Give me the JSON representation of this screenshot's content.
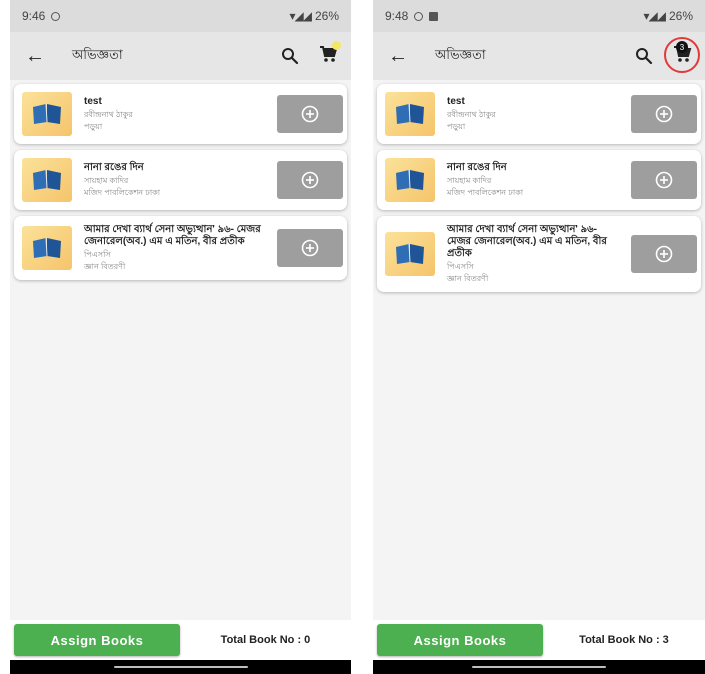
{
  "screens": [
    {
      "status": {
        "time": "9:46",
        "battery": "26%"
      },
      "appbar": {
        "title": "অভিজ্ঞতা",
        "cart_badge": ""
      },
      "books": [
        {
          "title": "test",
          "lines": [
            "রবীন্দ্রনাথ ঠাকুর",
            "পড়ুয়া"
          ]
        },
        {
          "title": "নানা রঙের দিন",
          "lines": [
            "সায়হাম কাদির",
            "মজিদ পাবলিকেশন ঢাকা"
          ]
        },
        {
          "title": "আমার দেখা ব্যার্থ সেনা অভ্যুত্থান' ৯৬- মেজর জেনারেল(অব.) এম এ মতিন, বীর প্রতীক",
          "lines": [
            "পিএসসি",
            "জ্ঞান বিতরণী"
          ]
        }
      ],
      "bottom": {
        "assign_label": "Assign Books",
        "total_label": "Total Book No : 0"
      }
    },
    {
      "status": {
        "time": "9:48",
        "battery": "26%"
      },
      "appbar": {
        "title": "অভিজ্ঞতা",
        "cart_badge": "3"
      },
      "books": [
        {
          "title": "test",
          "lines": [
            "রবীন্দ্রনাথ ঠাকুর",
            "পড়ুয়া"
          ]
        },
        {
          "title": "নানা রঙের দিন",
          "lines": [
            "সায়হাম কাদির",
            "মজিদ পাবলিকেশন ঢাকা"
          ]
        },
        {
          "title": "আমার দেখা ব্যার্থ সেনা অভ্যুত্থান' ৯৬- মেজর জেনারেল(অব.) এম এ মতিন, বীর প্রতীক",
          "lines": [
            "পিএসসি",
            "জ্ঞান বিতরণী"
          ]
        }
      ],
      "bottom": {
        "assign_label": "Assign Books",
        "total_label": "Total Book No : 3"
      }
    }
  ],
  "colors": {
    "assign_button": "#4caf50",
    "add_button": "#9e9e9e",
    "highlight_ring": "#e23a3a",
    "cart_dot": "#f5e663"
  },
  "icons": {
    "back": "arrow-left-icon",
    "search": "search-icon",
    "cart": "cart-icon",
    "add": "plus-circle-icon",
    "book": "book-cover-icon"
  }
}
